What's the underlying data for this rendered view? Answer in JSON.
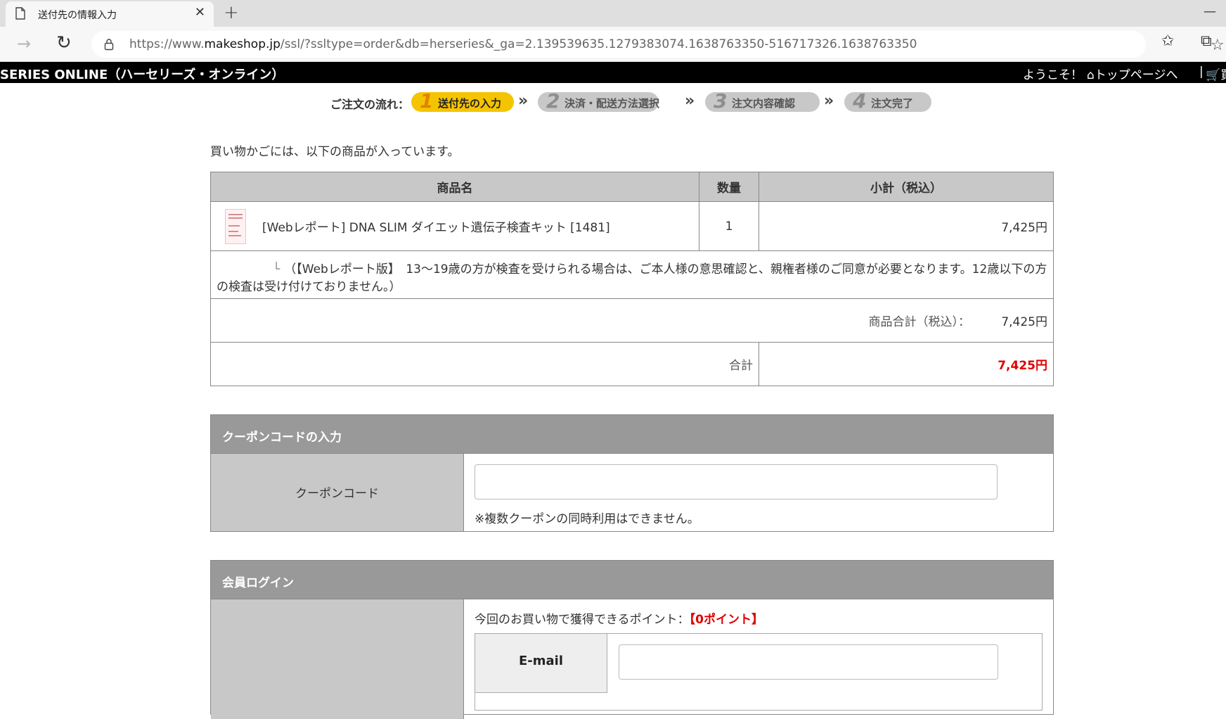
{
  "browser": {
    "tab_title": "送付先の情報入力",
    "new_tab_label": "+",
    "url_prefix": "https://www.",
    "url_domain": "makeshop.jp",
    "url_path": "/ssl/?ssltype=order&db=herseries&_ga=2.139539635.1279383074.1638763350-516717326.1638763350"
  },
  "header": {
    "site_title": "SERIES ONLINE（ハーセリーズ・オンライン）",
    "welcome": "ようこそ！",
    "top_page": "⌂トップページへ",
    "separator": "|",
    "cart": "🛒買"
  },
  "steps": {
    "label": "ご注文の流れ：",
    "items": [
      {
        "num": "1",
        "label": "送付先の入力",
        "active": true
      },
      {
        "num": "2",
        "label": "決済・配送方法選択",
        "active": false
      },
      {
        "num": "3",
        "label": "注文内容確認",
        "active": false
      },
      {
        "num": "4",
        "label": "注文完了",
        "active": false
      }
    ],
    "arrow": "»"
  },
  "cart": {
    "intro": "買い物かごには、以下の商品が入っています。",
    "headers": {
      "name": "商品名",
      "qty": "数量",
      "subtotal": "小計（税込）"
    },
    "item": {
      "name": "[Webレポート] DNA SLIM ダイエット遺伝子検査キット [1481]",
      "qty": "1",
      "price": "7,425円"
    },
    "option_tree": "└",
    "option_text": "（【Webレポート版】　13～19歳の方が検査を受けられる場合は、ご本人様の意思確認と、親権者様のご同意が必要となります。12歳以下の方の検査は受け付けておりません。）",
    "product_total_label": "商品合計（税込）：",
    "product_total": "7,425円",
    "grand_total_label": "合計",
    "grand_total": "7,425円"
  },
  "coupon": {
    "heading": "クーポンコードの入力",
    "label": "クーポンコード",
    "value": "",
    "note": "※複数クーポンの同時利用はできません。"
  },
  "login": {
    "heading": "会員ログイン",
    "points_text": "今回のお買い物で獲得できるポイント：",
    "points_value": "【0ポイント】",
    "email_label": "E-mail",
    "email_value": ""
  },
  "colors": {
    "accent_yellow": "#f5c400",
    "total_red": "#e00000",
    "section_head": "#999999",
    "header_bg": "#000000"
  }
}
